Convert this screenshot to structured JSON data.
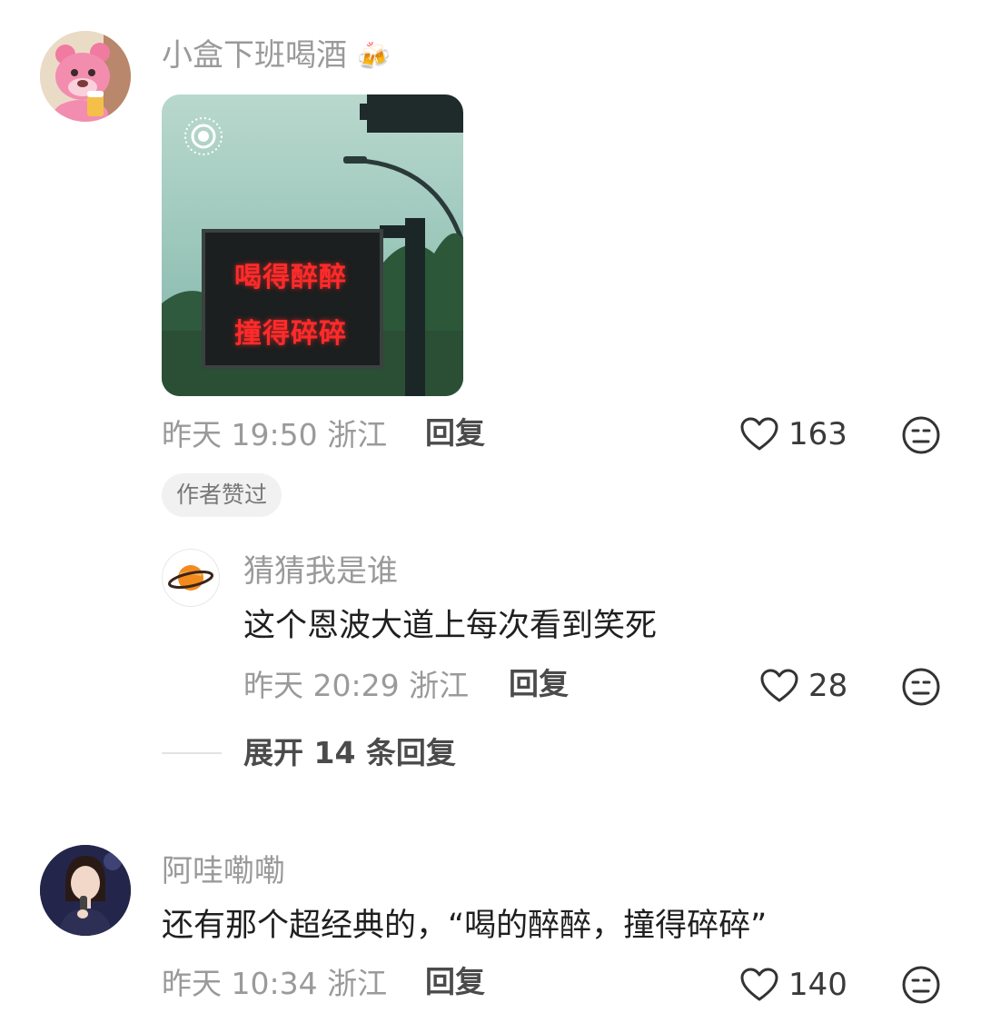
{
  "comments": [
    {
      "username": "小盒下班喝酒",
      "username_emoji": "🍻",
      "image": {
        "sign_line1": "喝得醉醉",
        "sign_line2": "撞得碎碎"
      },
      "time": "昨天 19:50 浙江",
      "reply_label": "回复",
      "likes": "163",
      "badge": "作者赞过",
      "replies": [
        {
          "username": "猜猜我是谁",
          "text": "这个恩波大道上每次看到笑死",
          "time": "昨天 20:29 浙江",
          "reply_label": "回复",
          "likes": "28"
        }
      ],
      "expand_label": "展开 14 条回复"
    },
    {
      "username": "阿哇嘞嘞",
      "text": "还有那个超经典的，“喝的醉醉，撞得碎碎”",
      "time": "昨天 10:34 浙江",
      "reply_label": "回复",
      "likes": "140"
    }
  ],
  "colors": {
    "username": "#9a9a9a",
    "content": "#1f1f1f",
    "sign_text": "#ff2b2b",
    "badge_bg": "#f1f1f1"
  },
  "icons": [
    "heart-outline-icon",
    "meh-face-icon",
    "live-photo-icon",
    "planet-avatar-icon",
    "beer-mugs-emoji"
  ]
}
